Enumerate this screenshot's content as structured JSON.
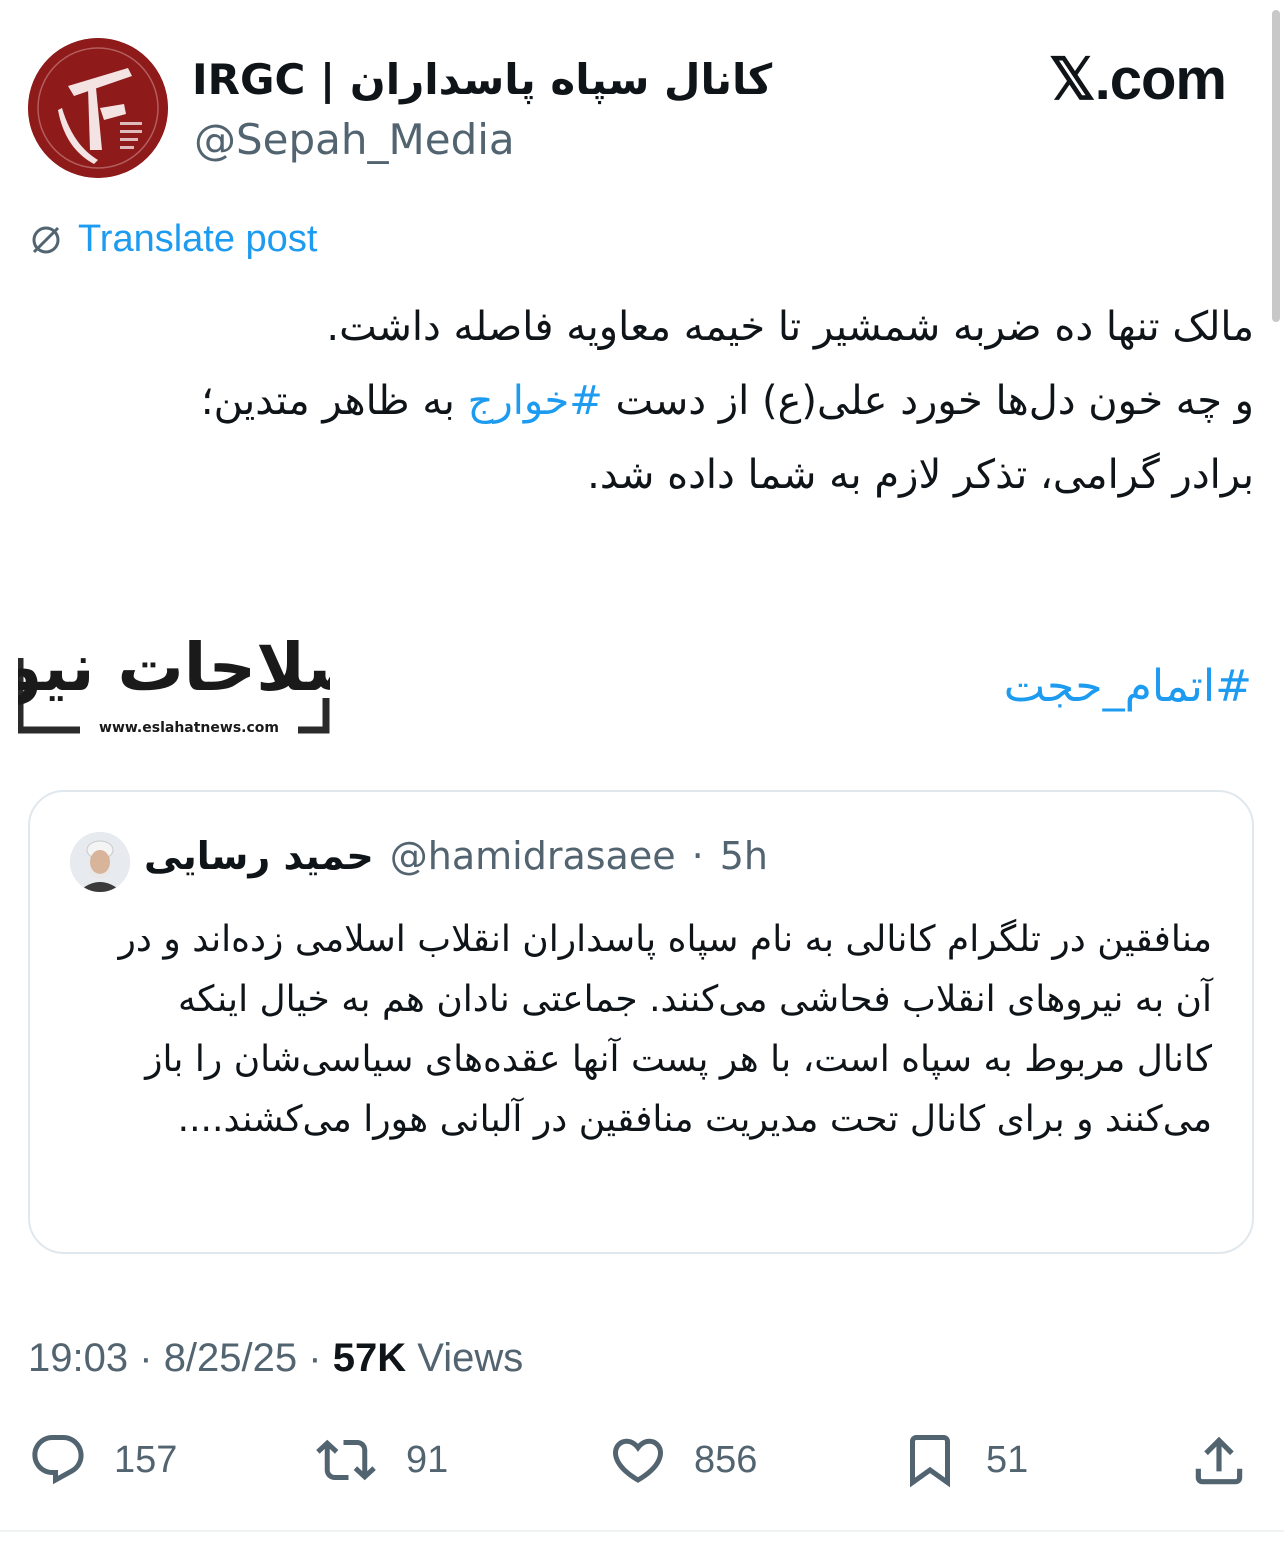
{
  "header": {
    "display_name": "IRGC | کانال سپاه پاسداران",
    "handle": "@Sepah_Media",
    "site": "𝕏.com"
  },
  "translate_label": "Translate post",
  "tweet": {
    "line1": "مالک تنها ده ضربه شمشیر تا خیمه معاویه فاصله داشت.",
    "line2_pre": "و چه خون دل‌ها خورد علی(ع) از دست ",
    "line2_hashtag": "#خوارج",
    "line2_post": " به ظاهر متدین؛",
    "line3": "برادر گرامی، تذکر لازم به شما داده شد.",
    "hashtag_final": "#اتمام_حجت"
  },
  "watermark": {
    "logo_text": "اصلاحات نیوز",
    "url": "www.eslahatnews.com"
  },
  "quote": {
    "name": "حمید رسایی",
    "handle": "@hamidrasaee",
    "separator": "·",
    "time": "5h",
    "body": "منافقین در تلگرام کانالی به نام سپاه پاسداران انقلاب اسلامی زده‌اند و در آن به نیروهای انقلاب فحاشی می‌کنند. جماعتی نادان هم به خیال اینکه کانال مربوط به سپاه است، با هر پست آنها عقده‌های سیاسی‌شان را باز می‌کنند و برای کانال تحت مدیریت منافقین در آلبانی هورا می‌کشند...."
  },
  "meta": {
    "time": "19:03",
    "dot": "·",
    "date": "8/25/25",
    "views_count": "57K",
    "views_label": "Views"
  },
  "actions": {
    "replies": "157",
    "reposts": "91",
    "likes": "856",
    "bookmarks": "51"
  },
  "colors": {
    "link": "#1d9bf0",
    "secondary_text": "#536471",
    "avatar_red": "#8e1a1a"
  }
}
